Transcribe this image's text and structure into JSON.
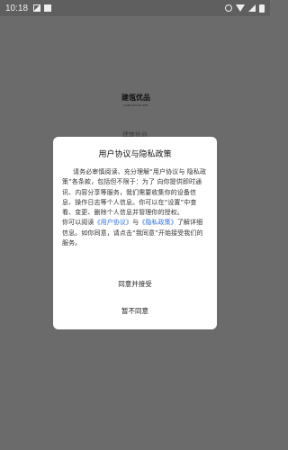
{
  "status_bar": {
    "time": "10:18"
  },
  "splash": {
    "logo_text": "建瓴优品",
    "logo_sub": "JIANLINGYOUPIN",
    "app_name": "建筑优品"
  },
  "dialog": {
    "title": "用户协议与隐私政策",
    "para1": "请务必审慎阅读、充分理解“用户协议与 隐私政策”各条款，包括但不限于：为了 向你提供即时通讯、内容分享等服务，我们需要收集你的设备信息、操作日志等个人信息。你可以在“设置”中查看、变更、删除个人信息并管理你的授权。",
    "para2_prefix": "你可以阅读",
    "link_user": "《用户协议》",
    "para2_and": "与",
    "link_privacy": "《隐私政策》",
    "para2_suffix": "了解详细信息。如你同意，请点击“我同意”开始接受我们的服务。",
    "agree_label": "同意并接受",
    "disagree_label": "暂不同意"
  }
}
